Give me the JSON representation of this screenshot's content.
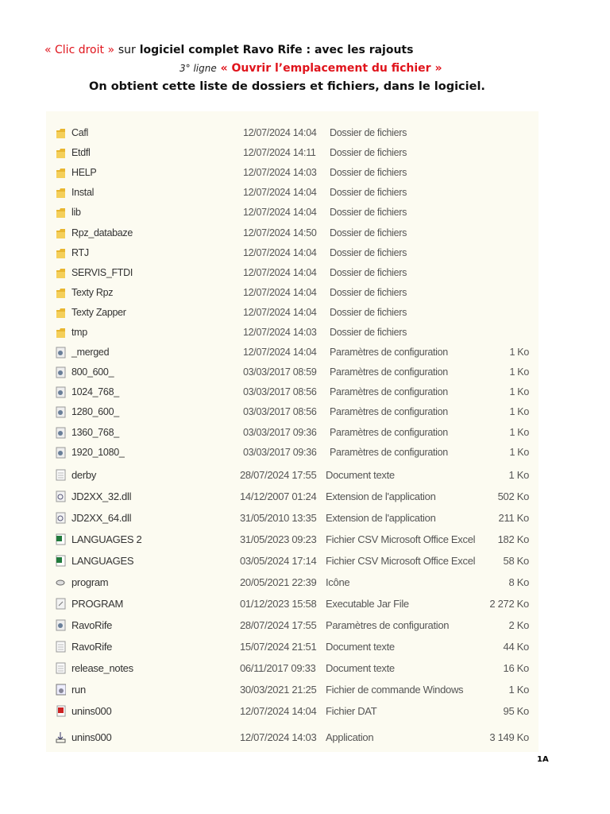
{
  "header": {
    "line1_red": "« Clic droit »",
    "line1_sur": "sur",
    "line1_rest": "logiciel complet Ravo Rife : avec les rajouts",
    "line2_prefix": "3° ligne",
    "line2_red": "« Ouvrir l’emplacement du fichier »",
    "line3": "On obtient cette liste de dossiers et fichiers, dans le logiciel."
  },
  "files": [
    {
      "name": "Cafl",
      "date": "12/07/2024 14:04",
      "type": "Dossier de fichiers",
      "size": "",
      "icon": "folder"
    },
    {
      "name": "Etdfl",
      "date": "12/07/2024 14:11",
      "type": "Dossier de fichiers",
      "size": "",
      "icon": "folder"
    },
    {
      "name": "HELP",
      "date": "12/07/2024 14:03",
      "type": "Dossier de fichiers",
      "size": "",
      "icon": "folder"
    },
    {
      "name": "Instal",
      "date": "12/07/2024 14:04",
      "type": "Dossier de fichiers",
      "size": "",
      "icon": "folder"
    },
    {
      "name": "lib",
      "date": "12/07/2024 14:04",
      "type": "Dossier de fichiers",
      "size": "",
      "icon": "folder"
    },
    {
      "name": "Rpz_databaze",
      "date": "12/07/2024 14:50",
      "type": "Dossier de fichiers",
      "size": "",
      "icon": "folder"
    },
    {
      "name": "RTJ",
      "date": "12/07/2024 14:04",
      "type": "Dossier de fichiers",
      "size": "",
      "icon": "folder"
    },
    {
      "name": "SERVIS_FTDI",
      "date": "12/07/2024 14:04",
      "type": "Dossier de fichiers",
      "size": "",
      "icon": "folder"
    },
    {
      "name": "Texty Rpz",
      "date": "12/07/2024 14:04",
      "type": "Dossier de fichiers",
      "size": "",
      "icon": "folder"
    },
    {
      "name": "Texty Zapper",
      "date": "12/07/2024 14:04",
      "type": "Dossier de fichiers",
      "size": "",
      "icon": "folder"
    },
    {
      "name": "tmp",
      "date": "12/07/2024 14:03",
      "type": "Dossier de fichiers",
      "size": "",
      "icon": "folder"
    },
    {
      "name": "_merged",
      "date": "12/07/2024 14:04",
      "type": "Paramètres de configuration",
      "size": "1 Ko",
      "icon": "config"
    },
    {
      "name": "800_600_",
      "date": "03/03/2017 08:59",
      "type": "Paramètres de configuration",
      "size": "1 Ko",
      "icon": "config"
    },
    {
      "name": "1024_768_",
      "date": "03/03/2017 08:56",
      "type": "Paramètres de configuration",
      "size": "1 Ko",
      "icon": "config"
    },
    {
      "name": "1280_600_",
      "date": "03/03/2017 08:56",
      "type": "Paramètres de configuration",
      "size": "1 Ko",
      "icon": "config"
    },
    {
      "name": "1360_768_",
      "date": "03/03/2017 09:36",
      "type": "Paramètres de configuration",
      "size": "1 Ko",
      "icon": "config"
    },
    {
      "name": "1920_1080_",
      "date": "03/03/2017 09:36",
      "type": "Paramètres de configuration",
      "size": "1 Ko",
      "icon": "config"
    },
    {
      "name": "derby",
      "date": "28/07/2024 17:55",
      "type": "Document texte",
      "size": "1 Ko",
      "icon": "text"
    },
    {
      "name": "JD2XX_32.dll",
      "date": "14/12/2007 01:24",
      "type": "Extension de l'application",
      "size": "502 Ko",
      "icon": "dll"
    },
    {
      "name": "JD2XX_64.dll",
      "date": "31/05/2010 13:35",
      "type": "Extension de l'application",
      "size": "211 Ko",
      "icon": "dll"
    },
    {
      "name": "LANGUAGES 2",
      "date": "31/05/2023 09:23",
      "type": "Fichier CSV Microsoft Office Excel",
      "size": "182 Ko",
      "icon": "excel"
    },
    {
      "name": "LANGUAGES",
      "date": "03/05/2024 17:14",
      "type": "Fichier CSV Microsoft Office Excel",
      "size": "58 Ko",
      "icon": "excel"
    },
    {
      "name": "program",
      "date": "20/05/2021 22:39",
      "type": "Icône",
      "size": "8 Ko",
      "icon": "ico"
    },
    {
      "name": "PROGRAM",
      "date": "01/12/2023 15:58",
      "type": "Executable Jar File",
      "size": "2 272 Ko",
      "icon": "jar"
    },
    {
      "name": "RavoRife",
      "date": "28/07/2024 17:55",
      "type": "Paramètres de configuration",
      "size": "2 Ko",
      "icon": "config"
    },
    {
      "name": "RavoRife",
      "date": "15/07/2024 21:51",
      "type": "Document texte",
      "size": "44 Ko",
      "icon": "text"
    },
    {
      "name": "release_notes",
      "date": "06/11/2017 09:33",
      "type": "Document texte",
      "size": "16 Ko",
      "icon": "text"
    },
    {
      "name": "run",
      "date": "30/03/2021 21:25",
      "type": "Fichier de commande Windows",
      "size": "1 Ko",
      "icon": "cmd"
    },
    {
      "name": "unins000",
      "date": "12/07/2024 14:04",
      "type": "Fichier DAT",
      "size": "95 Ko",
      "icon": "dat"
    },
    {
      "name": "unins000",
      "date": "12/07/2024 14:03",
      "type": "Application",
      "size": "3 149 Ko",
      "icon": "installer"
    }
  ],
  "page_number": "1A"
}
